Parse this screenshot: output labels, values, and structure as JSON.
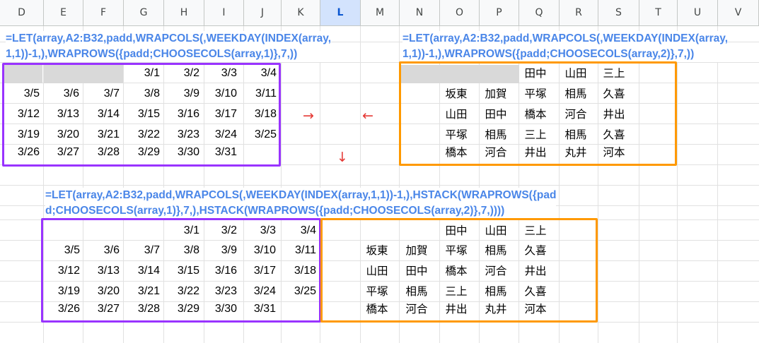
{
  "sheet": {
    "columns": [
      "D",
      "E",
      "F",
      "G",
      "H",
      "I",
      "J",
      "K",
      "L",
      "M",
      "N",
      "O",
      "P",
      "Q",
      "R",
      "S",
      "T",
      "U",
      "V"
    ],
    "selected_column": "L"
  },
  "formulas": {
    "top_left": [
      "=LET(array,A2:B32,padd,WRAPCOLS(,WEEKDAY(INDEX(array,",
      "1,1))-1,),WRAPROWS({padd;CHOOSECOLS(array,1)},7,))"
    ],
    "top_right": [
      "=LET(array,A2:B32,padd,WRAPCOLS(,WEEKDAY(INDEX(array,",
      "1,1))-1,),WRAPROWS({padd;CHOOSECOLS(array,2)},7,))"
    ],
    "bottom": [
      "=LET(array,A2:B32,padd,WRAPCOLS(,WEEKDAY(INDEX(array,1,1))-1,),HSTACK(WRAPROWS({pad",
      "d;CHOOSECOLS(array,1)},7,),HSTACK(WRAPROWS({padd;CHOOSECOLS(array,2)},7,))))"
    ]
  },
  "dates": [
    [
      "",
      "",
      "",
      "3/1",
      "3/2",
      "3/3",
      "3/4"
    ],
    [
      "3/5",
      "3/6",
      "3/7",
      "3/8",
      "3/9",
      "3/10",
      "3/11"
    ],
    [
      "3/12",
      "3/13",
      "3/14",
      "3/15",
      "3/16",
      "3/17",
      "3/18"
    ],
    [
      "3/19",
      "3/20",
      "3/21",
      "3/22",
      "3/23",
      "3/24",
      "3/25"
    ],
    [
      "3/26",
      "3/27",
      "3/28",
      "3/29",
      "3/30",
      "3/31",
      ""
    ]
  ],
  "names": [
    [
      "",
      "",
      "",
      "田中",
      "山田",
      "三上",
      ""
    ],
    [
      "",
      "坂東",
      "加賀",
      "平塚",
      "相馬",
      "久喜",
      ""
    ],
    [
      "",
      "山田",
      "田中",
      "橋本",
      "河合",
      "井出",
      ""
    ],
    [
      "",
      "平塚",
      "相馬",
      "三上",
      "相馬",
      "久喜",
      ""
    ],
    [
      "",
      "橋本",
      "河合",
      "井出",
      "丸井",
      "河本",
      ""
    ]
  ],
  "arrows": {
    "right": "→",
    "left": "←",
    "down": "↓"
  },
  "colors": {
    "purple": "#9933ff",
    "orange": "#ff9900",
    "formula": "#4a86e8",
    "arrow": "#e53935",
    "pad_gray": "#d9d9d9"
  }
}
